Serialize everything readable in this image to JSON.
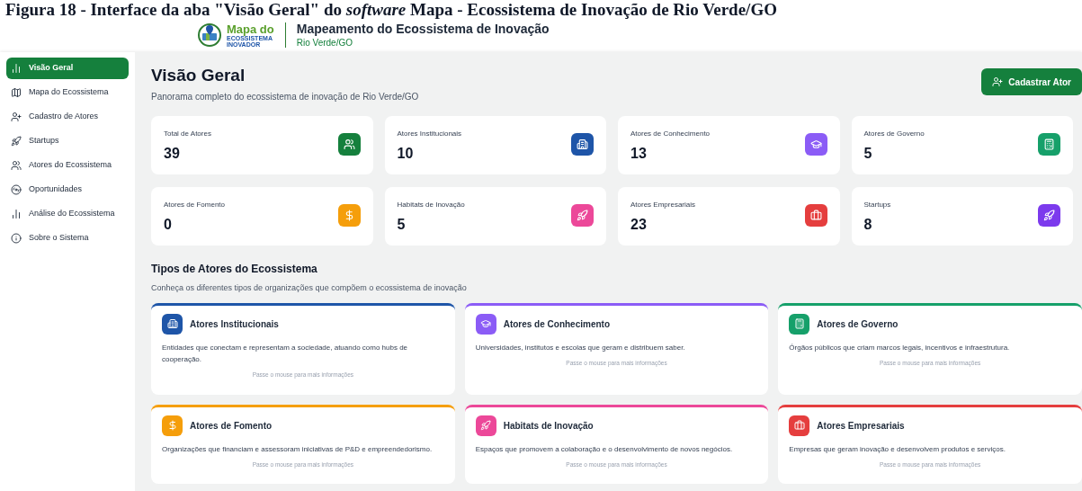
{
  "caption": "Figura 18 - Interface da aba \"Visão Geral\" do *software* Mapa - Ecossistema de Inovação de Rio Verde/GO",
  "header": {
    "logo_title": "Mapa do",
    "logo_subtitle_1": "ECOSSISTEMA",
    "logo_subtitle_2": "INOVADOR",
    "title": "Mapeamento do Ecossistema de Inovação",
    "subtitle": "Rio Verde/GO"
  },
  "sidebar": {
    "items": [
      {
        "label": "Visão Geral",
        "selected": true
      },
      {
        "label": "Mapa do Ecossistema",
        "selected": false
      },
      {
        "label": "Cadastro de Atores",
        "selected": false
      },
      {
        "label": "Startups",
        "selected": false
      },
      {
        "label": "Atores do Ecossistema",
        "selected": false
      },
      {
        "label": "Oportunidades",
        "selected": false
      },
      {
        "label": "Análise do Ecossistema",
        "selected": false
      },
      {
        "label": "Sobre o Sistema",
        "selected": false
      }
    ]
  },
  "page": {
    "title": "Visão Geral",
    "subtitle": "Panorama completo do ecossistema de inovação de Rio Verde/GO",
    "action_button": "Cadastrar Ator"
  },
  "stats": [
    {
      "label": "Total de Atores",
      "value": "39",
      "color": "#15803d"
    },
    {
      "label": "Atores Institucionais",
      "value": "10",
      "color": "#1e55a8"
    },
    {
      "label": "Atores de Conhecimento",
      "value": "13",
      "color": "#8b5cf6"
    },
    {
      "label": "Atores de Governo",
      "value": "5",
      "color": "#16a06a"
    },
    {
      "label": "Atores de Fomento",
      "value": "0",
      "color": "#f59e0b"
    },
    {
      "label": "Habitats de Inovação",
      "value": "5",
      "color": "#ec4899"
    },
    {
      "label": "Atores Empresariais",
      "value": "23",
      "color": "#e53e3e"
    },
    {
      "label": "Startups",
      "value": "8",
      "color": "#7c3aed"
    }
  ],
  "types_section": {
    "title": "Tipos de Atores do Ecossistema",
    "subtitle": "Conheça os diferentes tipos de organizações que compõem o ecossistema de inovação",
    "cards": [
      {
        "title": "Atores Institucionais",
        "description": "Entidades que conectam e representam a sociedade, atuando como hubs de cooperação.",
        "hint": "Passe o mouse para mais informações",
        "color": "#1e55a8"
      },
      {
        "title": "Atores de Conhecimento",
        "description": "Universidades, institutos e escolas que geram e distribuem saber.",
        "hint": "Passe o mouse para mais informações",
        "color": "#8b5cf6"
      },
      {
        "title": "Atores de Governo",
        "description": "Órgãos públicos que criam marcos legais, incentivos e infraestrutura.",
        "hint": "Passe o mouse para mais informações",
        "color": "#16a06a"
      },
      {
        "title": "Atores de Fomento",
        "description": "Organizações que financiam e assessoram iniciativas de P&D e empreendedorismo.",
        "hint": "Passe o mouse para mais informações",
        "color": "#f59e0b"
      },
      {
        "title": "Habitats de Inovação",
        "description": "Espaços que promovem a colaboração e o desenvolvimento de novos negócios.",
        "hint": "Passe o mouse para mais informações",
        "color": "#ec4899"
      },
      {
        "title": "Atores Empresariais",
        "description": "Empresas que geram inovação e desenvolvem produtos e serviços.",
        "hint": "Passe o mouse para mais informações",
        "color": "#e53e3e"
      }
    ]
  }
}
